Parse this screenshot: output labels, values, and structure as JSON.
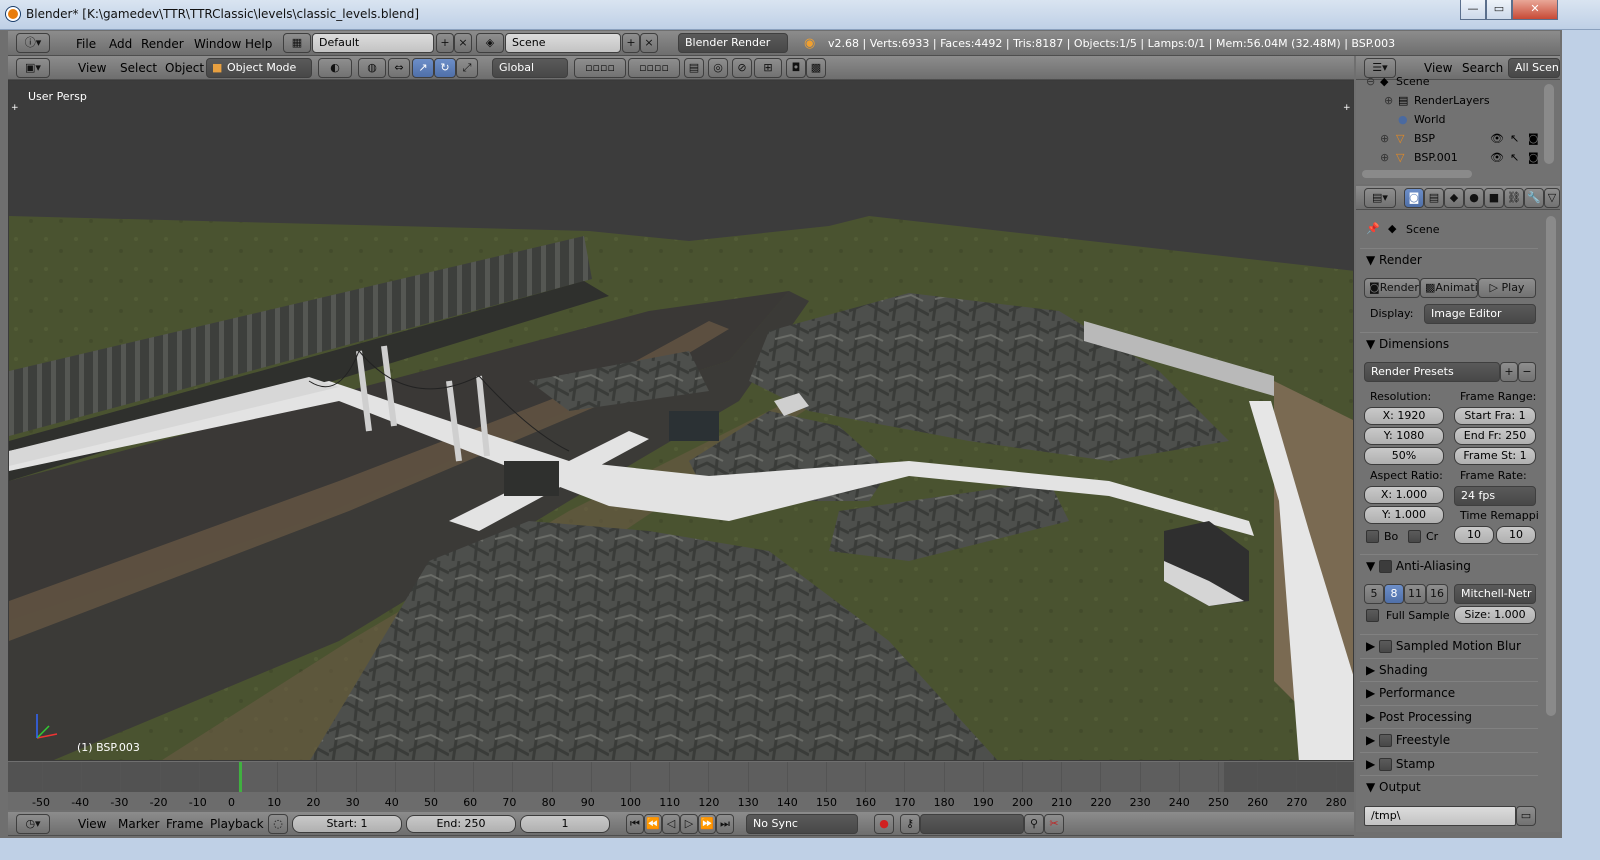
{
  "window": {
    "title": "Blender* [K:\\gamedev\\TTR\\TTRClassic\\levels\\classic_levels.blend]",
    "min_label": "—",
    "max_label": "▭",
    "close_label": "✕"
  },
  "info_header": {
    "menus": [
      "File",
      "Add",
      "Render",
      "Window",
      "Help"
    ],
    "layout": "Default",
    "scene": "Scene",
    "engine": "Blender Render",
    "stats": "v2.68 | Verts:6933 | Faces:4492 | Tris:8187 | Objects:1/5 | Lamps:0/1 | Mem:56.04M (32.48M) | BSP.003"
  },
  "view3d_header": {
    "menus": [
      "View",
      "Select",
      "Object"
    ],
    "mode": "Object Mode",
    "orientation": "Global"
  },
  "viewport": {
    "view_label": "User Persp",
    "object_label": "(1) BSP.003"
  },
  "outliner": {
    "menus": [
      "View",
      "Search"
    ],
    "display": "All Scenes",
    "items": [
      {
        "label": "Scene",
        "icon": "scene-icon"
      },
      {
        "label": "RenderLayers",
        "icon": "renderlayers-icon"
      },
      {
        "label": "World",
        "icon": "world-icon"
      },
      {
        "label": "BSP",
        "icon": "mesh-icon"
      },
      {
        "label": "BSP.001",
        "icon": "mesh-icon"
      }
    ]
  },
  "properties": {
    "context": "Scene",
    "render": {
      "title": "Render",
      "render_btn": "Render",
      "anim_btn": "Animati",
      "play_btn": "Play",
      "display_label": "Display:",
      "display_value": "Image Editor"
    },
    "dimensions": {
      "title": "Dimensions",
      "presets": "Render Presets",
      "resolution_label": "Resolution:",
      "res_x": "X: 1920",
      "res_y": "Y: 1080",
      "res_pct": "50%",
      "frame_range_label": "Frame Range:",
      "start": "Start Fra: 1",
      "end": "End Fr: 250",
      "step": "Frame St: 1",
      "aspect_label": "Aspect Ratio:",
      "asp_x": "X: 1.000",
      "asp_y": "Y: 1.000",
      "frame_rate_label": "Frame Rate:",
      "fps": "24 fps",
      "remap_label": "Time Remappi",
      "remap_old": "10",
      "remap_new": "10",
      "border": "Bo",
      "crop": "Cr"
    },
    "aa": {
      "title": "Anti-Aliasing",
      "samples": [
        "5",
        "8",
        "11",
        "16"
      ],
      "active_sample": "8",
      "filter": "Mitchell-Netr",
      "full_sample": "Full Sample",
      "size": "Size: 1.000"
    },
    "panels": [
      "Sampled Motion Blur",
      "Shading",
      "Performance",
      "Post Processing",
      "Freestyle",
      "Stamp",
      "Output"
    ],
    "output_path": "/tmp\\"
  },
  "timeline": {
    "ticks": [
      "-50",
      "-40",
      "-30",
      "-20",
      "-10",
      "0",
      "10",
      "20",
      "30",
      "40",
      "50",
      "60",
      "70",
      "80",
      "90",
      "100",
      "110",
      "120",
      "130",
      "140",
      "150",
      "160",
      "170",
      "180",
      "190",
      "200",
      "210",
      "220",
      "230",
      "240",
      "250",
      "260",
      "270",
      "280"
    ],
    "current_frame_marker": 1
  },
  "timeline_header": {
    "menus": [
      "View",
      "Marker",
      "Frame",
      "Playback"
    ],
    "start": "Start: 1",
    "end": "End: 250",
    "current": "1",
    "sync": "No Sync"
  }
}
